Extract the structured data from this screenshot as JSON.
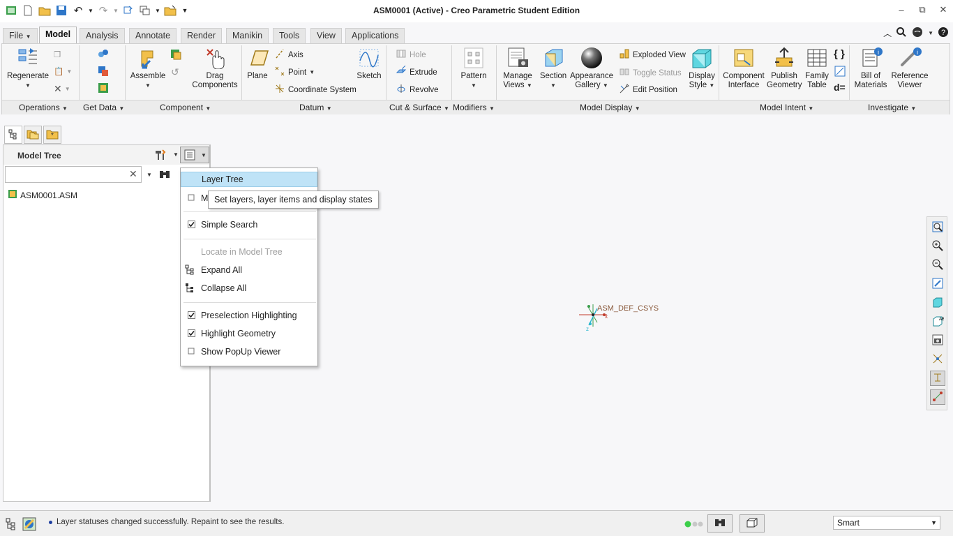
{
  "window": {
    "title": "ASM0001 (Active) - Creo Parametric Student Edition",
    "min": "–",
    "restore": "⧉",
    "close": "✕"
  },
  "tabs": [
    {
      "label": "File"
    },
    {
      "label": "Model"
    },
    {
      "label": "Analysis"
    },
    {
      "label": "Annotate"
    },
    {
      "label": "Render"
    },
    {
      "label": "Manikin"
    },
    {
      "label": "Tools"
    },
    {
      "label": "View"
    },
    {
      "label": "Applications"
    }
  ],
  "ribbon": {
    "regenerate": "Regenerate",
    "assemble": "Assemble",
    "drag_components": [
      "Drag",
      "Components"
    ],
    "plane": "Plane",
    "axis": "Axis",
    "point": "Point",
    "coordinate_system": "Coordinate System",
    "sketch": "Sketch",
    "hole": "Hole",
    "extrude": "Extrude",
    "revolve": "Revolve",
    "pattern": "Pattern",
    "manage_views": [
      "Manage",
      "Views"
    ],
    "section": "Section",
    "appearance_gallery": [
      "Appearance",
      "Gallery"
    ],
    "exploded_view": "Exploded View",
    "toggle_status": "Toggle Status",
    "edit_position": "Edit Position",
    "display_style": [
      "Display",
      "Style"
    ],
    "component_interface": [
      "Component",
      "Interface"
    ],
    "publish_geometry": [
      "Publish",
      "Geometry"
    ],
    "family_table": [
      "Family",
      "Table"
    ],
    "bill_of_materials": [
      "Bill of",
      "Materials"
    ],
    "reference_viewer": [
      "Reference",
      "Viewer"
    ],
    "groups": {
      "operations": "Operations",
      "get_data": "Get Data",
      "component": "Component",
      "datum": "Datum",
      "cut_surface": "Cut & Surface",
      "modifiers": "Modifiers",
      "model_display": "Model Display",
      "model_intent": "Model Intent",
      "investigate": "Investigate"
    }
  },
  "tree": {
    "title": "Model Tree",
    "search_value": "",
    "root": "ASM0001.ASM"
  },
  "menu": {
    "items": [
      {
        "label": "Layer Tree",
        "checked": false,
        "highlighted": true
      },
      {
        "label": "M",
        "checked": false
      },
      {
        "label": "Simple Search",
        "checked": true
      },
      {
        "label": "Locate in Model Tree",
        "disabled": true
      },
      {
        "label": "Expand All"
      },
      {
        "label": "Collapse All"
      },
      {
        "label": "Preselection Highlighting",
        "checked": true
      },
      {
        "label": "Highlight Geometry",
        "checked": true
      },
      {
        "label": "Show PopUp Viewer",
        "checked": false
      }
    ],
    "tooltip": "Set layers, layer items and display states"
  },
  "canvas": {
    "csys_label": "ASM_DEF_CSYS",
    "axis_x": "x",
    "axis_z": "z"
  },
  "status": {
    "message": "Layer statuses changed successfully. Repaint to see the results.",
    "filter": "Smart"
  },
  "colors": {
    "highlight": "#bfe3f7",
    "accent": "#2b7bd0"
  }
}
